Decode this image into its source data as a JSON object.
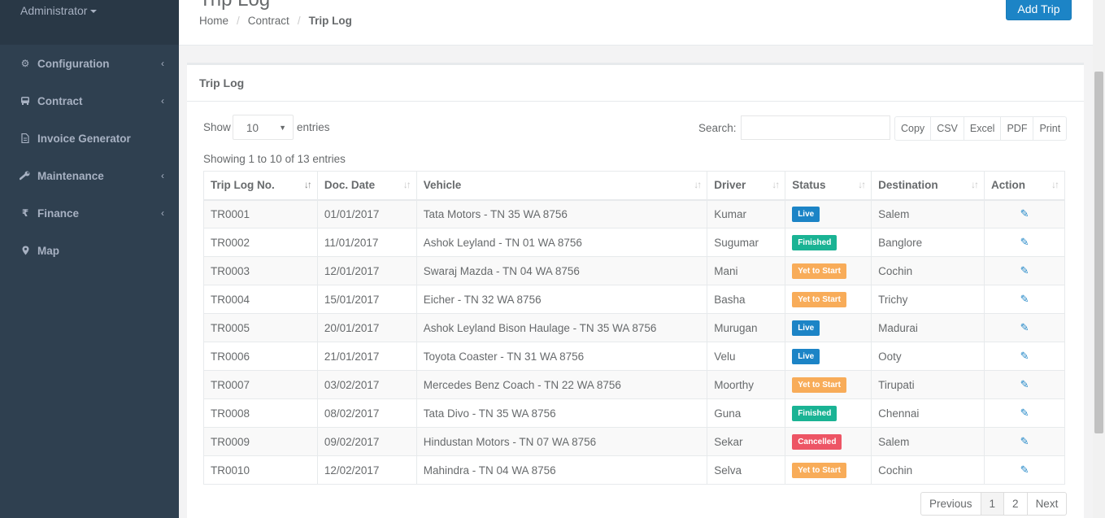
{
  "sidebar": {
    "user": "Administrator",
    "items": [
      {
        "label": "Configuration",
        "icon": "gear-icon",
        "has_children": true
      },
      {
        "label": "Contract",
        "icon": "bus-icon",
        "has_children": true
      },
      {
        "label": "Invoice Generator",
        "icon": "file-icon",
        "has_children": false
      },
      {
        "label": "Maintenance",
        "icon": "wrench-icon",
        "has_children": true
      },
      {
        "label": "Finance",
        "icon": "rupee-icon",
        "has_children": true
      },
      {
        "label": "Map",
        "icon": "map-marker-icon",
        "has_children": false
      }
    ]
  },
  "header": {
    "title": "Trip Log",
    "breadcrumb": [
      "Home",
      "Contract",
      "Trip Log"
    ],
    "add_button": "Add Trip"
  },
  "panel": {
    "title": "Trip Log",
    "show_label": "Show",
    "entries_value": "10",
    "entries_label": "entries",
    "search_label": "Search:",
    "export_buttons": [
      "Copy",
      "CSV",
      "Excel",
      "PDF",
      "Print"
    ],
    "info": "Showing 1 to 10 of 13 entries"
  },
  "table": {
    "columns": [
      "Trip Log No.",
      "Doc. Date",
      "Vehicle",
      "Driver",
      "Status",
      "Destination",
      "Action"
    ],
    "rows": [
      {
        "no": "TR0001",
        "date": "01/01/2017",
        "vehicle": "Tata Motors - TN 35 WA 8756",
        "driver": "Kumar",
        "status": "Live",
        "status_type": "live",
        "destination": "Salem"
      },
      {
        "no": "TR0002",
        "date": "11/01/2017",
        "vehicle": "Ashok Leyland - TN 01 WA 8756",
        "driver": "Sugumar",
        "status": "Finished",
        "status_type": "finished",
        "destination": "Banglore"
      },
      {
        "no": "TR0003",
        "date": "12/01/2017",
        "vehicle": "Swaraj Mazda - TN 04 WA 8756",
        "driver": "Mani",
        "status": "Yet to Start",
        "status_type": "yet",
        "destination": "Cochin"
      },
      {
        "no": "TR0004",
        "date": "15/01/2017",
        "vehicle": "Eicher - TN 32 WA 8756",
        "driver": "Basha",
        "status": "Yet to Start",
        "status_type": "yet",
        "destination": "Trichy"
      },
      {
        "no": "TR0005",
        "date": "20/01/2017",
        "vehicle": "Ashok Leyland Bison Haulage - TN 35 WA 8756",
        "driver": "Murugan",
        "status": "Live",
        "status_type": "live",
        "destination": "Madurai"
      },
      {
        "no": "TR0006",
        "date": "21/01/2017",
        "vehicle": "Toyota Coaster - TN 31 WA 8756",
        "driver": "Velu",
        "status": "Live",
        "status_type": "live",
        "destination": "Ooty"
      },
      {
        "no": "TR0007",
        "date": "03/02/2017",
        "vehicle": "Mercedes Benz Coach - TN 22 WA 8756",
        "driver": "Moorthy",
        "status": "Yet to Start",
        "status_type": "yet",
        "destination": "Tirupati"
      },
      {
        "no": "TR0008",
        "date": "08/02/2017",
        "vehicle": "Tata Divo - TN 35 WA 8756",
        "driver": "Guna",
        "status": "Finished",
        "status_type": "finished",
        "destination": "Chennai"
      },
      {
        "no": "TR0009",
        "date": "09/02/2017",
        "vehicle": "Hindustan Motors - TN 07 WA 8756",
        "driver": "Sekar",
        "status": "Cancelled",
        "status_type": "cancelled",
        "destination": "Salem"
      },
      {
        "no": "TR0010",
        "date": "12/02/2017",
        "vehicle": "Mahindra - TN 04 WA 8756",
        "driver": "Selva",
        "status": "Yet to Start",
        "status_type": "yet",
        "destination": "Cochin"
      }
    ]
  },
  "pagination": {
    "previous": "Previous",
    "pages": [
      "1",
      "2"
    ],
    "current": "1",
    "next": "Next"
  },
  "colors": {
    "sidebar_bg": "#2f4050",
    "primary": "#1c84c6",
    "live": "#1c84c6",
    "finished": "#1ab394",
    "yet_to_start": "#f8ac59",
    "cancelled": "#ed5565"
  }
}
